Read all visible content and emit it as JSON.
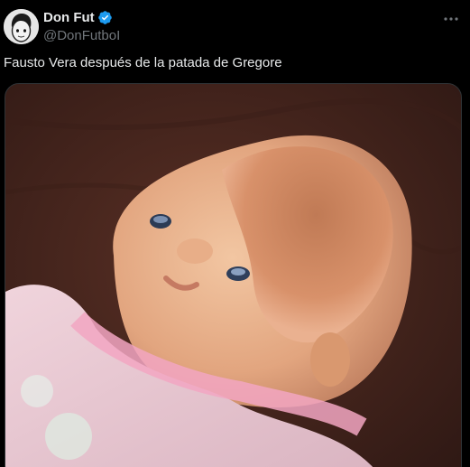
{
  "author": {
    "display_name": "Don Fut",
    "handle": "@DonFutboI",
    "verified": true,
    "verified_color": "#1d9bf0"
  },
  "tweet": {
    "text": "Fausto Vera después de la patada de Gregore"
  },
  "icons": {
    "verified": "verified-badge-icon",
    "more": "more-horizontal-icon"
  },
  "media": {
    "kind": "photo",
    "subject": "doll-with-dented-head"
  }
}
